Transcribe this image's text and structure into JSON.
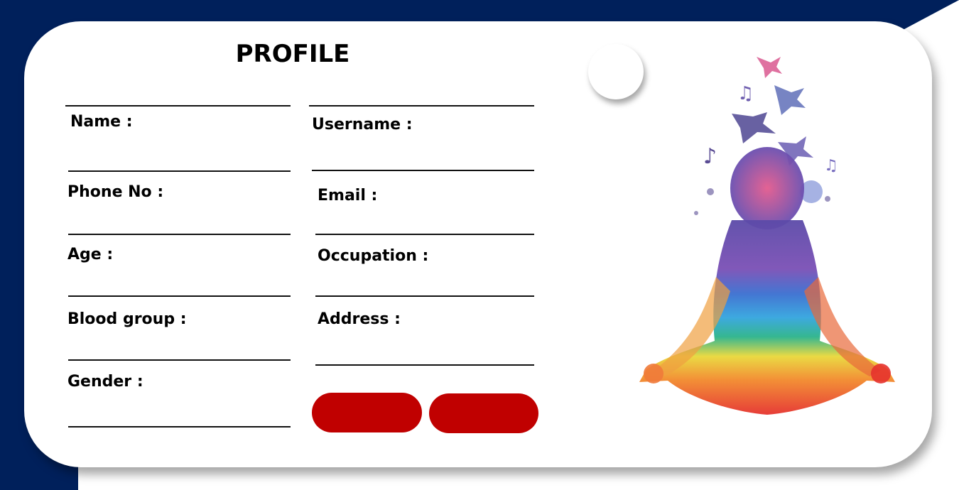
{
  "card": {
    "title": "PROFILE"
  },
  "fields": {
    "left": [
      {
        "id": "name",
        "label": "Name :"
      },
      {
        "id": "phone",
        "label": "Phone No :"
      },
      {
        "id": "age",
        "label": "Age :"
      },
      {
        "id": "blood",
        "label": "Blood group :"
      },
      {
        "id": "gender",
        "label": "Gender :"
      }
    ],
    "right": [
      {
        "id": "username",
        "label": "Username :"
      },
      {
        "id": "email",
        "label": "Email :"
      },
      {
        "id": "occupation",
        "label": "Occupation :"
      },
      {
        "id": "address",
        "label": "Address :"
      }
    ]
  },
  "buttons": {
    "primary": "",
    "secondary": ""
  },
  "colors": {
    "navy": "#00205b",
    "button_red": "#c00000"
  },
  "decor": {
    "illustration": "meditation-watercolor-figure-with-birds-and-music-notes",
    "knob": "circle-knob"
  }
}
